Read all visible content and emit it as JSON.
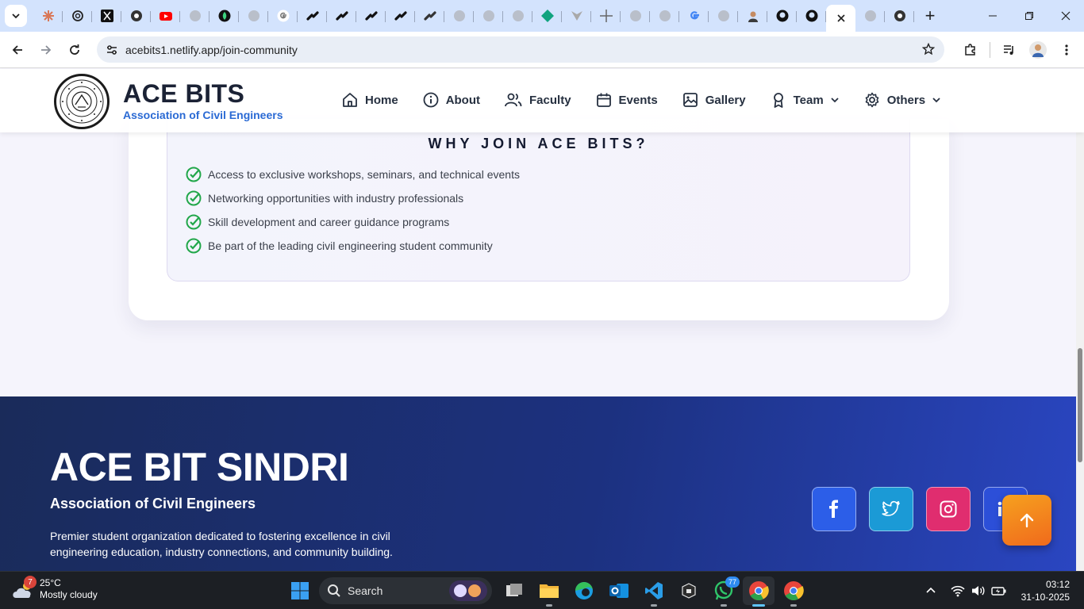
{
  "browser": {
    "url": "acebits1.netlify.app/join-community",
    "new_tab_label": "+"
  },
  "navbar": {
    "brand_title": "ACE BITS",
    "brand_subtitle": "Association of Civil Engineers",
    "links": [
      {
        "label": "Home",
        "icon": "home-icon"
      },
      {
        "label": "About",
        "icon": "info-icon"
      },
      {
        "label": "Faculty",
        "icon": "users-icon"
      },
      {
        "label": "Events",
        "icon": "calendar-icon"
      },
      {
        "label": "Gallery",
        "icon": "image-icon"
      },
      {
        "label": "Team",
        "icon": "award-icon",
        "dropdown": true
      },
      {
        "label": "Others",
        "icon": "gear-icon",
        "dropdown": true
      }
    ]
  },
  "why_join": {
    "title": "WHY JOIN ACE BITS?",
    "benefits": [
      "Access to exclusive workshops, seminars, and technical events",
      "Networking opportunities with industry professionals",
      "Skill development and career guidance programs",
      "Be part of the leading civil engineering student community"
    ]
  },
  "footer": {
    "title": "ACE BIT SINDRI",
    "subtitle": "Association of Civil Engineers",
    "description": "Premier student organization dedicated to fostering excellence in civil engineering education, industry connections, and community building.",
    "social": [
      "facebook-icon",
      "twitter-icon",
      "instagram-icon",
      "linkedin-icon"
    ]
  },
  "taskbar": {
    "weather_badge": "7",
    "temperature": "25°C",
    "condition": "Mostly cloudy",
    "search_label": "Search",
    "whatsapp_badge": "77",
    "time": "03:12",
    "date": "31-10-2025"
  },
  "colors": {
    "accent_blue": "#2a6ad4",
    "check_green": "#22a74a",
    "footer_start": "#1a2b5a",
    "footer_end": "#2a46c2",
    "scroll_top_orange": "#f28a1e"
  }
}
